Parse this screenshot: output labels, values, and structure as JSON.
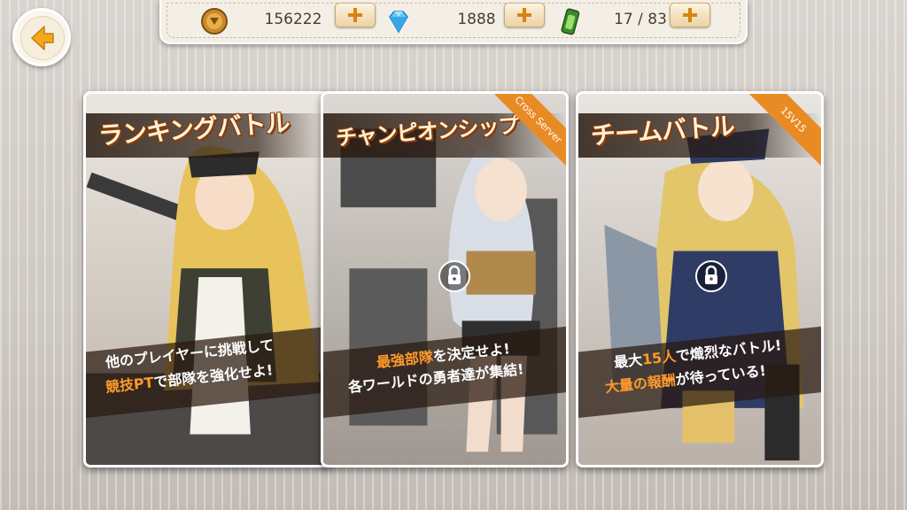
{
  "header": {
    "gold": {
      "icon": "gold-coin-icon",
      "value": "156222"
    },
    "diamond": {
      "icon": "diamond-icon",
      "value": "1888"
    },
    "stamina": {
      "icon": "stamina-battery-icon",
      "value": "17 / 83"
    }
  },
  "back_button": {
    "icon": "back-arrow-icon"
  },
  "cards": [
    {
      "title": "ランキングバトル",
      "badge": "",
      "desc_line1": [
        "他のプレイヤーに挑戦して"
      ],
      "desc_line2_hl": "競技PT",
      "desc_line2_rest": "で部隊を強化せよ!",
      "locked": false
    },
    {
      "title": "チャンピオンシップ",
      "badge": "Cross Server",
      "desc_line1_hl": "最強部隊",
      "desc_line1_rest": "を決定せよ!",
      "desc_line2": "各ワールドの勇者達が集結!",
      "locked": true
    },
    {
      "title": "チームバトル",
      "badge": "15V15",
      "desc_line1_pre": "最大",
      "desc_line1_hl": "15人",
      "desc_line1_rest": "で熾烈なバトル!",
      "desc_line2_hl": "大量の報酬",
      "desc_line2_rest": "が待っている!",
      "locked": true
    }
  ],
  "colors": {
    "accent": "#e98b24",
    "highlight": "#ff9a2a",
    "panel": "#f4efe6"
  }
}
